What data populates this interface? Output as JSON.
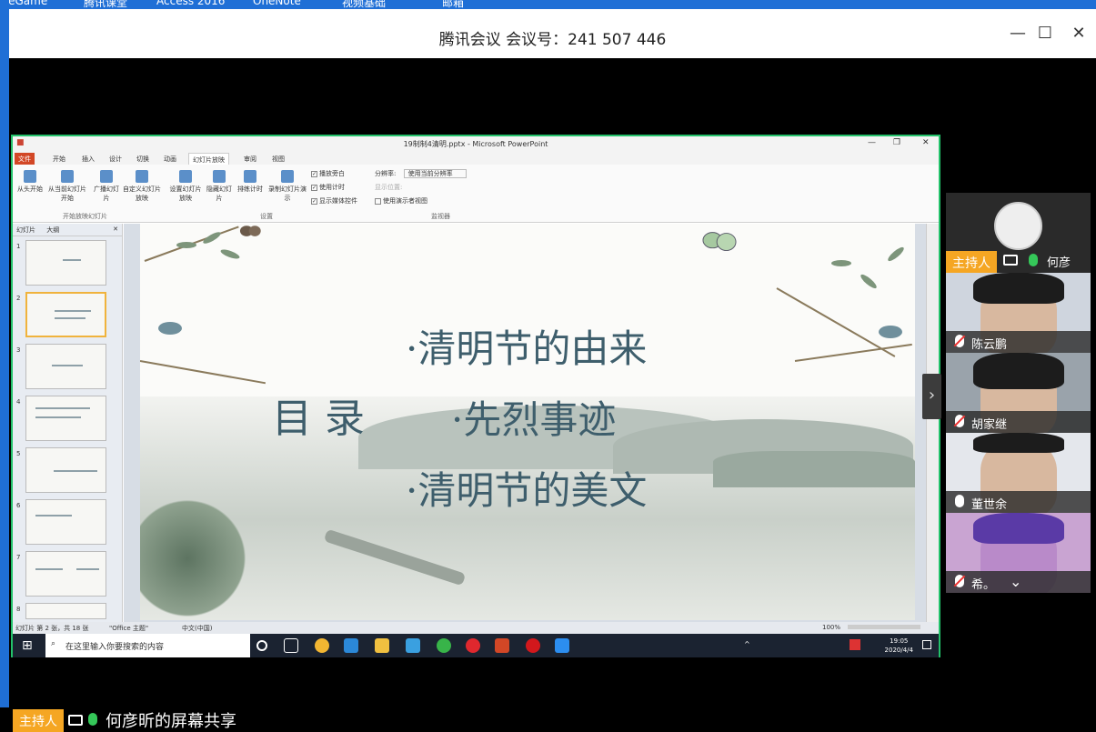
{
  "meeting": {
    "title": "腾讯会议 会议号：241 507 446",
    "minimize": "—",
    "maximize": "☐",
    "close": "✕"
  },
  "desktop_top_labels": [
    "veGame",
    "腾讯课堂",
    "Access 2016",
    "OneNote",
    "视频基础",
    "邮箱"
  ],
  "ppt": {
    "window_title": "19制制4清明.pptx - Microsoft PowerPoint",
    "tabs": [
      "文件",
      "开始",
      "插入",
      "设计",
      "切换",
      "动画",
      "幻灯片放映",
      "审阅",
      "视图"
    ],
    "active_tab": "幻灯片放映",
    "ribbon": {
      "from_start": "从头开始",
      "from_current": "从当前幻灯片开始",
      "broadcast": "广播幻灯片",
      "custom": "自定义幻灯片放映",
      "group1": "开始放映幻灯片",
      "setup": "设置幻灯片放映",
      "hide": "隐藏幻灯片",
      "rehearse": "排练计时",
      "record": "录制幻灯片演示",
      "play_narration": "播放旁白",
      "use_timings": "使用计时",
      "show_media": "显示媒体控件",
      "group2": "设置",
      "resolution_label": "分辨率:",
      "resolution_value": "使用当前分辨率",
      "show_on": "显示位置:",
      "presenter_view": "使用演示者视图",
      "group3": "监视器"
    },
    "pane_tabs": [
      "幻灯片",
      "大纲"
    ],
    "thumbnails": [
      "1",
      "2",
      "3",
      "4",
      "5",
      "6",
      "7",
      "8"
    ],
    "selected_slide": 2,
    "slide": {
      "title": "目 录",
      "items": [
        "·清明节的由来",
        "·先烈事迹",
        "·清明节的美文"
      ]
    },
    "status": {
      "slide_info": "幻灯片 第 2 张，共 18 张",
      "theme": "\"Office 主题\"",
      "language": "中文(中国)",
      "zoom": "100%"
    }
  },
  "taskbar": {
    "search_placeholder": "在这里输入你要搜索的内容",
    "time": "19:05",
    "date": "2020/4/4"
  },
  "participants": [
    {
      "name": "何彦昕...",
      "host": true,
      "host_label": "主持人",
      "mic": "on"
    },
    {
      "name": "陈云鹏",
      "host": false,
      "mic": "off"
    },
    {
      "name": "胡家继",
      "host": false,
      "mic": "off"
    },
    {
      "name": "董世余",
      "host": false,
      "mic": "on"
    },
    {
      "name": "希。",
      "host": false,
      "mic": "off"
    }
  ],
  "footer": {
    "host_label": "主持人",
    "share_text": "何彦昕的屏幕共享"
  },
  "colors": {
    "host_badge": "#f5a623",
    "share_border": "#23c26a",
    "slide_text": "#3e5e6c"
  }
}
